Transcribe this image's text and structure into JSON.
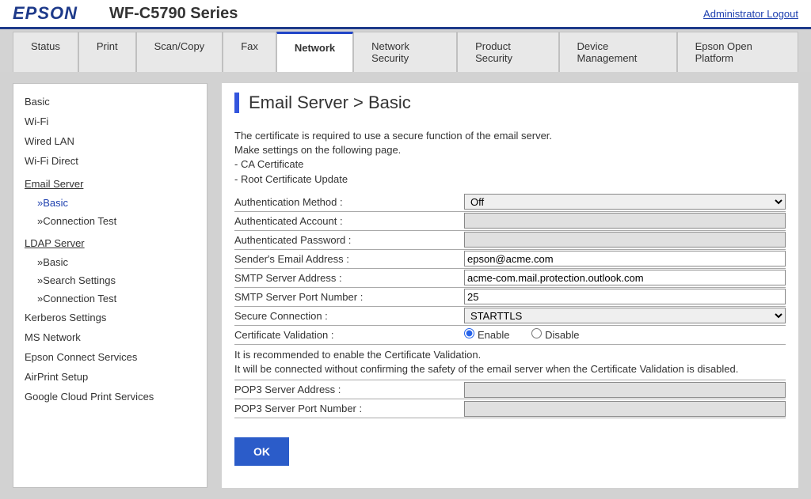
{
  "header": {
    "logo": "EPSON",
    "model": "WF-C5790 Series",
    "logout": "Administrator Logout"
  },
  "tabs": [
    "Status",
    "Print",
    "Scan/Copy",
    "Fax",
    "Network",
    "Network Security",
    "Product Security",
    "Device Management",
    "Epson Open Platform"
  ],
  "active_tab": "Network",
  "sidebar": {
    "items_top": [
      "Basic",
      "Wi-Fi",
      "Wired LAN",
      "Wi-Fi Direct"
    ],
    "email_server": {
      "label": "Email Server",
      "subs": [
        "»Basic",
        "»Connection Test"
      ],
      "selected": "»Basic"
    },
    "ldap_server": {
      "label": "LDAP Server",
      "subs": [
        "»Basic",
        "»Search Settings",
        "»Connection Test"
      ]
    },
    "items_bottom": [
      "Kerberos Settings",
      "MS Network",
      "Epson Connect Services",
      "AirPrint Setup",
      "Google Cloud Print Services"
    ]
  },
  "content": {
    "title": "Email Server > Basic",
    "desc_line1": "The certificate is required to use a secure function of the email server.",
    "desc_line2": "Make settings on the following page.",
    "desc_line3": "- CA Certificate",
    "desc_line4": "- Root Certificate Update",
    "fields": {
      "auth_method": {
        "label": "Authentication Method :",
        "value": "Off"
      },
      "auth_account": {
        "label": "Authenticated Account :",
        "value": ""
      },
      "auth_password": {
        "label": "Authenticated Password :",
        "value": ""
      },
      "sender_email": {
        "label": "Sender's Email Address :",
        "value": "epson@acme.com"
      },
      "smtp_addr": {
        "label": "SMTP Server Address :",
        "value": "acme-com.mail.protection.outlook.com"
      },
      "smtp_port": {
        "label": "SMTP Server Port Number :",
        "value": "25"
      },
      "secure_conn": {
        "label": "Secure Connection :",
        "value": "STARTTLS"
      },
      "cert_valid": {
        "label": "Certificate Validation :",
        "enable": "Enable",
        "disable": "Disable"
      },
      "note_line1": "It is recommended to enable the Certificate Validation.",
      "note_line2": "It will be connected without confirming the safety of the email server when the Certificate Validation is disabled.",
      "pop3_addr": {
        "label": "POP3 Server Address :",
        "value": ""
      },
      "pop3_port": {
        "label": "POP3 Server Port Number :",
        "value": ""
      }
    },
    "ok_button": "OK"
  }
}
